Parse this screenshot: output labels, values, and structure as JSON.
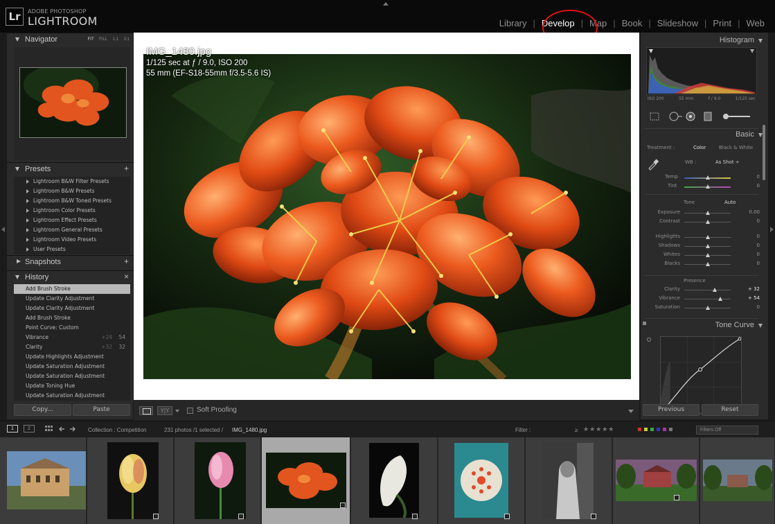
{
  "app": {
    "brand_small": "ADOBE PHOTOSHOP",
    "brand_name": "LIGHTROOM",
    "logo_text": "Lr",
    "modules": [
      "Library",
      "Develop",
      "Map",
      "Book",
      "Slideshow",
      "Print",
      "Web"
    ],
    "active_module": "Develop"
  },
  "left_panel": {
    "navigator": {
      "title": "Navigator",
      "modes": [
        "FIT",
        "FILL",
        "1:1",
        "3:1"
      ]
    },
    "presets": {
      "title": "Presets",
      "items": [
        "Lightroom B&W Filter Presets",
        "Lightroom B&W Presets",
        "Lightroom B&W Toned Presets",
        "Lightroom Color Presets",
        "Lightroom Effect Presets",
        "Lightroom General Presets",
        "Lightroom Video Presets",
        "User Presets"
      ]
    },
    "snapshots": {
      "title": "Snapshots"
    },
    "history": {
      "title": "History",
      "items": [
        {
          "label": "Add Brush Stroke",
          "v1": "",
          "v2": ""
        },
        {
          "label": "Update Clarity Adjustment",
          "v1": "",
          "v2": ""
        },
        {
          "label": "Update Clarity Adjustment",
          "v1": "",
          "v2": ""
        },
        {
          "label": "Add Brush Stroke",
          "v1": "",
          "v2": ""
        },
        {
          "label": "Point Curve: Custom",
          "v1": "",
          "v2": ""
        },
        {
          "label": "Vibrance",
          "v1": "+24",
          "v2": "54"
        },
        {
          "label": "Clarity",
          "v1": "+32",
          "v2": "32"
        },
        {
          "label": "Update Highlights Adjustment",
          "v1": "",
          "v2": ""
        },
        {
          "label": "Update Saturation Adjustment",
          "v1": "",
          "v2": ""
        },
        {
          "label": "Update Saturation Adjustment",
          "v1": "",
          "v2": ""
        },
        {
          "label": "Update Toning Hue",
          "v1": "",
          "v2": ""
        },
        {
          "label": "Update Saturation Adjustment",
          "v1": "",
          "v2": ""
        }
      ]
    },
    "copy_label": "Copy...",
    "paste_label": "Paste"
  },
  "image_info": {
    "filename": "IMG_1480.jpg",
    "exposure": "1/125 sec at ƒ / 9.0, ISO 200",
    "lens": "55 mm (EF-S18-55mm f/3.5-5.6 IS)"
  },
  "toolbar": {
    "soft_proofing_label": "Soft Proofing",
    "view_mode_2": "Y|Y"
  },
  "right_panel": {
    "histogram": {
      "title": "Histogram",
      "info": [
        "ISO 200",
        "55 mm",
        "f / 9.0",
        "1/125 sec"
      ]
    },
    "basic": {
      "title": "Basic",
      "treatment_label": "Treatment :",
      "treatment_color": "Color",
      "treatment_bw": "Black & White",
      "wb_label": "WB :",
      "wb_value": "As Shot ÷",
      "temp": {
        "label": "Temp",
        "value": "0",
        "pos": 0.5
      },
      "tint": {
        "label": "Tint",
        "value": "0",
        "pos": 0.5
      },
      "tone_label": "Tone",
      "auto_label": "Auto",
      "tone_rows": [
        {
          "label": "Exposure",
          "value": "0.00",
          "pos": 0.5
        },
        {
          "label": "Contrast",
          "value": "0",
          "pos": 0.5
        },
        {
          "label": "Highlights",
          "value": "0",
          "pos": 0.5
        },
        {
          "label": "Shadows",
          "value": "0",
          "pos": 0.5
        },
        {
          "label": "Whites",
          "value": "0",
          "pos": 0.5
        },
        {
          "label": "Blacks",
          "value": "0",
          "pos": 0.5
        }
      ],
      "presence_label": "Presence",
      "presence_rows": [
        {
          "label": "Clarity",
          "value": "+ 32",
          "pos": 0.66
        },
        {
          "label": "Vibrance",
          "value": "+ 54",
          "pos": 0.77
        },
        {
          "label": "Saturation",
          "value": "0",
          "pos": 0.5
        }
      ]
    },
    "tone_curve": {
      "title": "Tone Curve"
    },
    "previous_label": "Previous",
    "reset_label": "Reset"
  },
  "filmstrip_bar": {
    "view1": "1",
    "view2": "2",
    "collection": "Collection : Competition",
    "count": "231 photos /1 selected /",
    "selected_file": "IMG_1480.jpg",
    "filter_label": "Filter :",
    "filter_rating": "≥",
    "filters_off": "Filters Off"
  },
  "filmstrip": {
    "selected_index": 3,
    "thumbnails": [
      "building",
      "yellow-tulip",
      "pink-tulip",
      "orange-clivia",
      "white-calla-lily",
      "teal-flower-macro",
      "black-white-figure",
      "red-house",
      "house-trees"
    ]
  },
  "colors": {
    "accent": "#ffffff",
    "highlight_circle": "#e01010",
    "panel_bg": "#2b2b2b",
    "topbar_bg": "#0a0a0a"
  }
}
